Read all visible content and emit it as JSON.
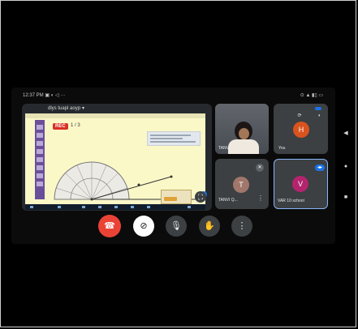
{
  "status_bar": {
    "time": "12:37 PM",
    "left_icons": "▣ ◐ ◁ ···",
    "right_icons": "⊙ ▲ ▮▯ ▭"
  },
  "screen_share": {
    "title": "dlys tuapl aoyp",
    "chevron": "▾",
    "rec_label": "REC",
    "page_count": "1 / 3",
    "fullscreen_icon": "⛶"
  },
  "participants": {
    "student": {
      "label": "TANVI"
    },
    "you": {
      "initial": "H",
      "label": "You",
      "color": "#d9531e"
    },
    "t": {
      "initial": "T",
      "label": "TANVI Q...",
      "color": "#a1776b"
    },
    "v": {
      "initial": "V",
      "label": "VAR 10 school",
      "color": "#b3246d"
    }
  },
  "controls": {
    "hangup": "☎",
    "camera": "⊘",
    "mic": "🎙",
    "hand": "✋",
    "more": "⋮"
  },
  "android_nav": {
    "back": "◀",
    "home": "●",
    "recents": "■"
  }
}
